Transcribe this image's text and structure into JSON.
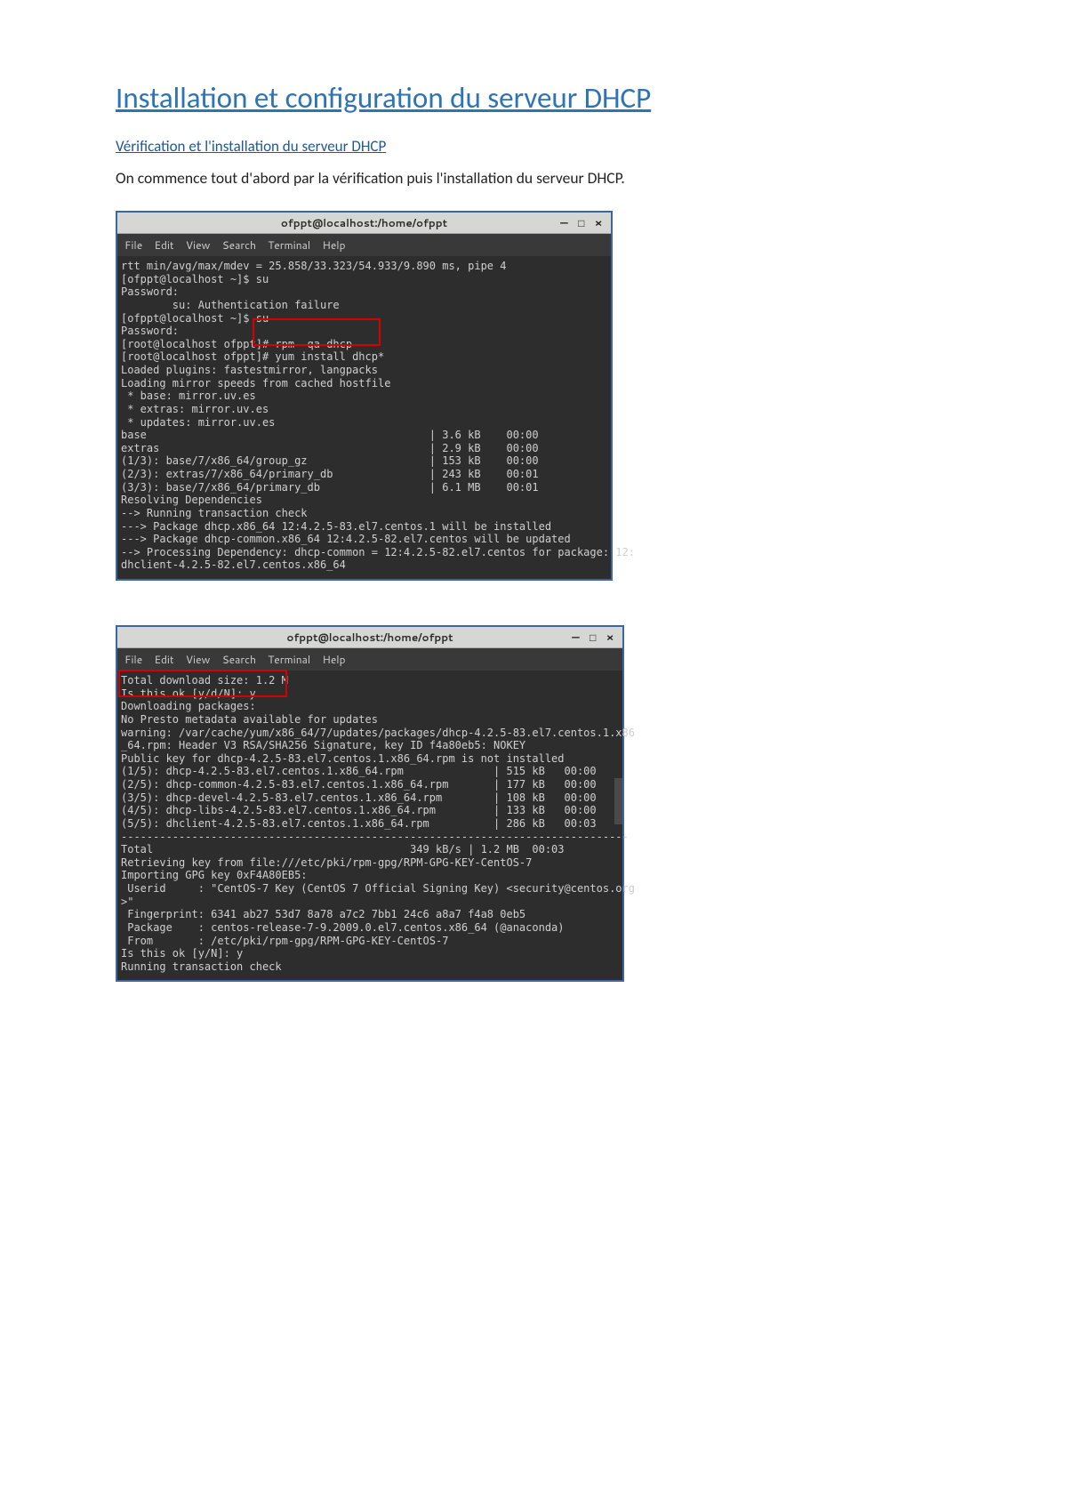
{
  "doc": {
    "title": "Installation et configuration du serveur DHCP",
    "subheading": "Vérification et l'installation du serveur DHCP",
    "intro": "On commence tout d'abord par la vérification puis l'installation du serveur DHCP."
  },
  "win1": {
    "title": "ofppt@localhost:/home/ofppt",
    "minimize": "—",
    "maximize": "□",
    "close": "×",
    "menu": {
      "file": "File",
      "edit": "Edit",
      "view": "View",
      "search": "Search",
      "terminal": "Terminal",
      "help": "Help"
    },
    "content": "rtt min/avg/max/mdev = 25.858/33.323/54.933/9.890 ms, pipe 4\n[ofppt@localhost ~]$ su\nPassword:\n        su: Authentication failure\n[ofppt@localhost ~]$ su\nPassword:\n[root@localhost ofppt]# rpm -qa dhcp\n[root@localhost ofppt]# yum install dhcp*\nLoaded plugins: fastestmirror, langpacks\nLoading mirror speeds from cached hostfile\n * base: mirror.uv.es\n * extras: mirror.uv.es\n * updates: mirror.uv.es\nbase                                            | 3.6 kB    00:00\nextras                                          | 2.9 kB    00:00\n(1/3): base/7/x86_64/group_gz                   | 153 kB    00:00\n(2/3): extras/7/x86_64/primary_db               | 243 kB    00:01\n(3/3): base/7/x86_64/primary_db                 | 6.1 MB    00:01\nResolving Dependencies\n--> Running transaction check\n---> Package dhcp.x86_64 12:4.2.5-83.el7.centos.1 will be installed\n---> Package dhcp-common.x86_64 12:4.2.5-82.el7.centos will be updated\n--> Processing Dependency: dhcp-common = 12:4.2.5-82.el7.centos for package: 12:\ndhclient-4.2.5-82.el7.centos.x86_64"
  },
  "win2": {
    "title": "ofppt@localhost:/home/ofppt",
    "minimize": "—",
    "maximize": "□",
    "close": "×",
    "menu": {
      "file": "File",
      "edit": "Edit",
      "view": "View",
      "search": "Search",
      "terminal": "Terminal",
      "help": "Help"
    },
    "content": "Total download size: 1.2 M\nIs this ok [y/d/N]: y\nDownloading packages:\nNo Presto metadata available for updates\nwarning: /var/cache/yum/x86_64/7/updates/packages/dhcp-4.2.5-83.el7.centos.1.x86\n_64.rpm: Header V3 RSA/SHA256 Signature, key ID f4a80eb5: NOKEY\nPublic key for dhcp-4.2.5-83.el7.centos.1.x86_64.rpm is not installed\n(1/5): dhcp-4.2.5-83.el7.centos.1.x86_64.rpm              | 515 kB   00:00\n(2/5): dhcp-common-4.2.5-83.el7.centos.1.x86_64.rpm       | 177 kB   00:00\n(3/5): dhcp-devel-4.2.5-83.el7.centos.1.x86_64.rpm        | 108 kB   00:00\n(4/5): dhcp-libs-4.2.5-83.el7.centos.1.x86_64.rpm         | 133 kB   00:00\n(5/5): dhclient-4.2.5-83.el7.centos.1.x86_64.rpm          | 286 kB   00:03\n-------------------------------------------------------------------------------\nTotal                                        349 kB/s | 1.2 MB  00:03\nRetrieving key from file:///etc/pki/rpm-gpg/RPM-GPG-KEY-CentOS-7\nImporting GPG key 0xF4A80EB5:\n Userid     : \"CentOS-7 Key (CentOS 7 Official Signing Key) <security@centos.org\n>\"\n Fingerprint: 6341 ab27 53d7 8a78 a7c2 7bb1 24c6 a8a7 f4a8 0eb5\n Package    : centos-release-7-9.2009.0.el7.centos.x86_64 (@anaconda)\n From       : /etc/pki/rpm-gpg/RPM-GPG-KEY-CentOS-7\nIs this ok [y/N]: y\nRunning transaction check"
  }
}
